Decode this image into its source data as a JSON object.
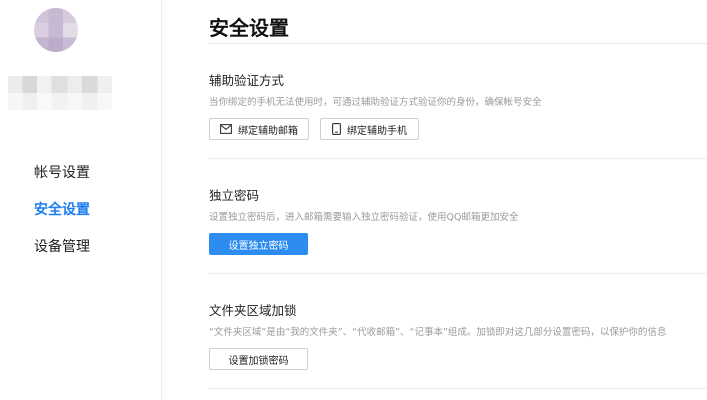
{
  "sidebar": {
    "nav": [
      {
        "label": "帐号设置"
      },
      {
        "label": "安全设置",
        "active": true
      },
      {
        "label": "设备管理"
      }
    ]
  },
  "main": {
    "title": "安全设置",
    "sections": [
      {
        "title": "辅助验证方式",
        "desc": "当你绑定的手机无法使用时，可通过辅助验证方式验证你的身份，确保帐号安全",
        "buttons": [
          {
            "label": "绑定辅助邮箱",
            "icon": "mail-icon"
          },
          {
            "label": "绑定辅助手机",
            "icon": "phone-icon"
          }
        ]
      },
      {
        "title": "独立密码",
        "desc": "设置独立密码后，进入邮箱需要输入独立密码验证，使用QQ邮箱更加安全",
        "buttons": [
          {
            "label": "设置独立密码"
          }
        ]
      },
      {
        "title": "文件夹区域加锁",
        "desc": "“文件夹区域”是由“我的文件夹”、“代收邮箱”、“记事本”组成。加锁即对这几部分设置密码，以保护你的信息",
        "buttons": [
          {
            "label": "设置加锁密码"
          }
        ]
      }
    ]
  },
  "colors": {
    "accent": "#2d8cf0",
    "active_nav": "#1c7ef0"
  }
}
